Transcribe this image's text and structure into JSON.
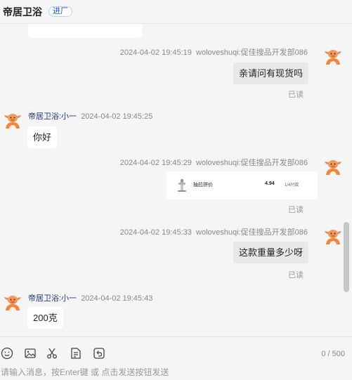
{
  "header": {
    "title": "帝居卫浴",
    "tag": "进厂"
  },
  "messages": [
    {
      "side": "right",
      "time": "2024-04-02 19:45:19",
      "nick": "woloveshuqi:促佳搜品开发部086",
      "text": "亲请问有现货吗",
      "status": "已读"
    },
    {
      "side": "left",
      "nick": "帝居卫浴:小一",
      "time": "2024-04-02 19:45:25",
      "text": "你好"
    },
    {
      "side": "right",
      "time": "2024-04-02 19:45:29",
      "nick": "woloveshuqi:促佳搜品开发部086",
      "card": {
        "name": "抽拉拼价",
        "price": "4.94",
        "pages": "1/4付款"
      },
      "status": "已读"
    },
    {
      "side": "right",
      "time": "2024-04-02 19:45:33",
      "nick": "woloveshuqi:促佳搜品开发部086",
      "text": "这款重量多少呀",
      "status": "已读"
    },
    {
      "side": "left",
      "nick": "帝居卫浴:小一",
      "time": "2024-04-02 19:45:43",
      "text": "200克"
    }
  ],
  "toolbar": {
    "icons": [
      "emoji-icon",
      "image-icon",
      "scissors-icon",
      "document-icon",
      "recall-icon"
    ],
    "counter": "0 / 500"
  },
  "input": {
    "value": "",
    "placeholder": "请输入消息，按Enter键 或 点击发送按钮发送"
  },
  "colors": {
    "nick": "#1f3a7a",
    "tag": "#1a4fd6",
    "bubble_right": "#e8e8e8",
    "bubble_left": "#ffffff"
  }
}
